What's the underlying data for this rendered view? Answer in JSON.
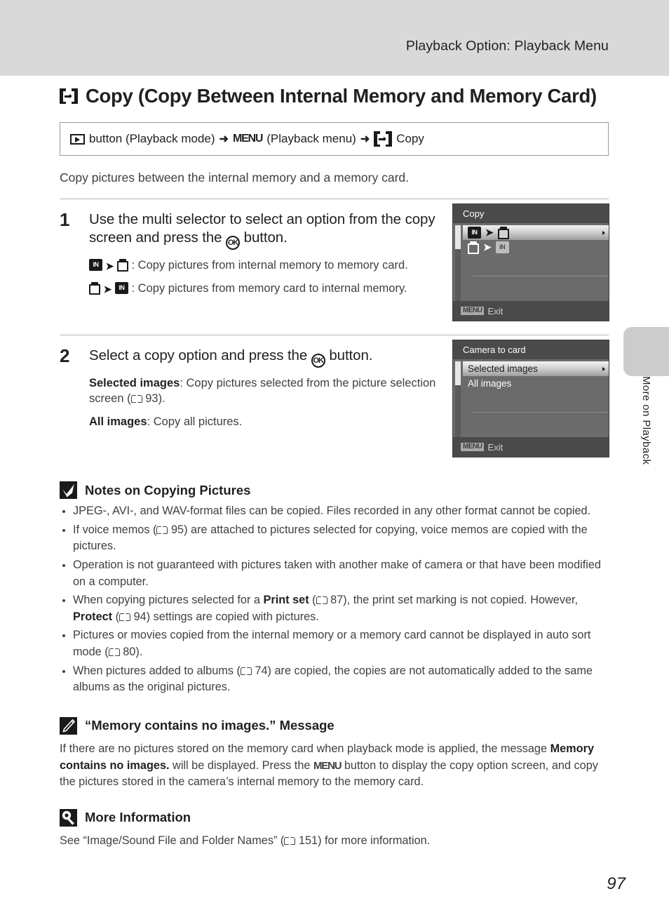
{
  "header": {
    "title": "Playback Option: Playback Menu"
  },
  "side_tab": {
    "label": "More on Playback"
  },
  "page": {
    "title": "Copy (Copy Between Internal Memory and Memory Card)",
    "title_icon": "copy-icon",
    "number": "97"
  },
  "path_box": {
    "play_button_icon": "playback-button-icon",
    "part1": "button (Playback mode)",
    "arrow1": "➜",
    "menu_label": "MENU",
    "part2": "(Playback menu)",
    "arrow2": "➜",
    "copy_icon": "copy-icon",
    "part3": "Copy"
  },
  "intro": "Copy pictures between the internal memory and a memory card.",
  "steps": [
    {
      "number": "1",
      "heading_before": "Use the multi selector to select an option from the copy screen and press the",
      "ok_icon": "ok-button-icon",
      "heading_after": "button.",
      "options": [
        {
          "from_icon": "internal-memory-icon",
          "to_icon": "memory-card-icon",
          "text": ": Copy pictures from internal memory to memory card."
        },
        {
          "from_icon": "memory-card-icon",
          "to_icon": "internal-memory-icon",
          "text": ": Copy pictures from memory card to internal memory."
        }
      ],
      "screen": {
        "title": "Copy",
        "items": [
          {
            "type": "icons",
            "from_icon": "internal-memory-icon",
            "to_icon": "memory-card-icon",
            "selected": true
          },
          {
            "type": "icons",
            "from_icon": "memory-card-icon",
            "to_icon": "internal-memory-icon",
            "selected": false
          }
        ],
        "footer_chip": "MENU",
        "footer_text": "Exit"
      }
    },
    {
      "number": "2",
      "heading_before": "Select a copy option and press the",
      "ok_icon": "ok-button-icon",
      "heading_after": "button.",
      "descriptions": [
        {
          "term": "Selected images",
          "body_before": ": Copy pictures selected from the picture selection screen (",
          "ref_icon": "book-reference-icon",
          "ref_page": "93",
          "body_after": ")."
        },
        {
          "term": "All images",
          "body_before": ": Copy all pictures.",
          "ref_icon": "",
          "ref_page": "",
          "body_after": ""
        }
      ],
      "screen": {
        "title": "Camera to card",
        "items": [
          {
            "type": "text",
            "label": "Selected images",
            "selected": true
          },
          {
            "type": "text",
            "label": "All images",
            "selected": false
          }
        ],
        "footer_chip": "MENU",
        "footer_text": "Exit"
      }
    }
  ],
  "notes": {
    "icon": "checkmark-note-icon",
    "title": "Notes on Copying Pictures",
    "bullets": [
      {
        "parts": [
          {
            "t": "text",
            "v": "JPEG-, AVI-, and WAV-format files can be copied. Files recorded in any other format cannot be copied."
          }
        ]
      },
      {
        "parts": [
          {
            "t": "text",
            "v": "If voice memos ("
          },
          {
            "t": "book",
            "v": "book-reference-icon"
          },
          {
            "t": "text",
            "v": " 95) are attached to pictures selected for copying, voice memos are copied with the pictures."
          }
        ]
      },
      {
        "parts": [
          {
            "t": "text",
            "v": "Operation is not guaranteed with pictures taken with another make of camera or that have been modified on a computer."
          }
        ]
      },
      {
        "parts": [
          {
            "t": "text",
            "v": "When copying pictures selected for a "
          },
          {
            "t": "bold",
            "v": "Print set"
          },
          {
            "t": "text",
            "v": " ("
          },
          {
            "t": "book",
            "v": "book-reference-icon"
          },
          {
            "t": "text",
            "v": " 87), the print set marking is not copied. However, "
          },
          {
            "t": "bold",
            "v": "Protect"
          },
          {
            "t": "text",
            "v": " ("
          },
          {
            "t": "book",
            "v": "book-reference-icon"
          },
          {
            "t": "text",
            "v": " 94) settings are copied with pictures."
          }
        ]
      },
      {
        "parts": [
          {
            "t": "text",
            "v": "Pictures or movies copied from the internal memory or a memory card cannot be displayed in auto sort mode ("
          },
          {
            "t": "book",
            "v": "book-reference-icon"
          },
          {
            "t": "text",
            "v": " 80)."
          }
        ]
      },
      {
        "parts": [
          {
            "t": "text",
            "v": "When pictures added to albums ("
          },
          {
            "t": "book",
            "v": "book-reference-icon"
          },
          {
            "t": "text",
            "v": " 74) are copied, the copies are not automatically added to the same albums as the original pictures."
          }
        ]
      }
    ]
  },
  "memory_message": {
    "icon": "pencil-note-icon",
    "title": "“Memory contains no images.” Message",
    "body_1": "If there are no pictures stored on the memory card when playback mode is applied, the message ",
    "bold_1": "Memory contains no images.",
    "body_2": " will be displayed. Press the ",
    "menu_label": "MENU",
    "body_3": " button to display the copy option screen, and copy the pictures stored in the camera’s internal memory to the memory card."
  },
  "more_info": {
    "icon": "magnifier-note-icon",
    "title": "More Information",
    "body_before": "See “Image/Sound File and Folder Names” (",
    "ref_icon": "book-reference-icon",
    "ref_page": "151",
    "body_after": ") for more information."
  },
  "colors": {
    "header_band": "#d9d9d9",
    "side_tab": "#cccccc",
    "screen_bg": "#6b6b6b",
    "screen_chrome": "#4a4a4a",
    "text": "#231f20",
    "body_text": "#414042"
  }
}
